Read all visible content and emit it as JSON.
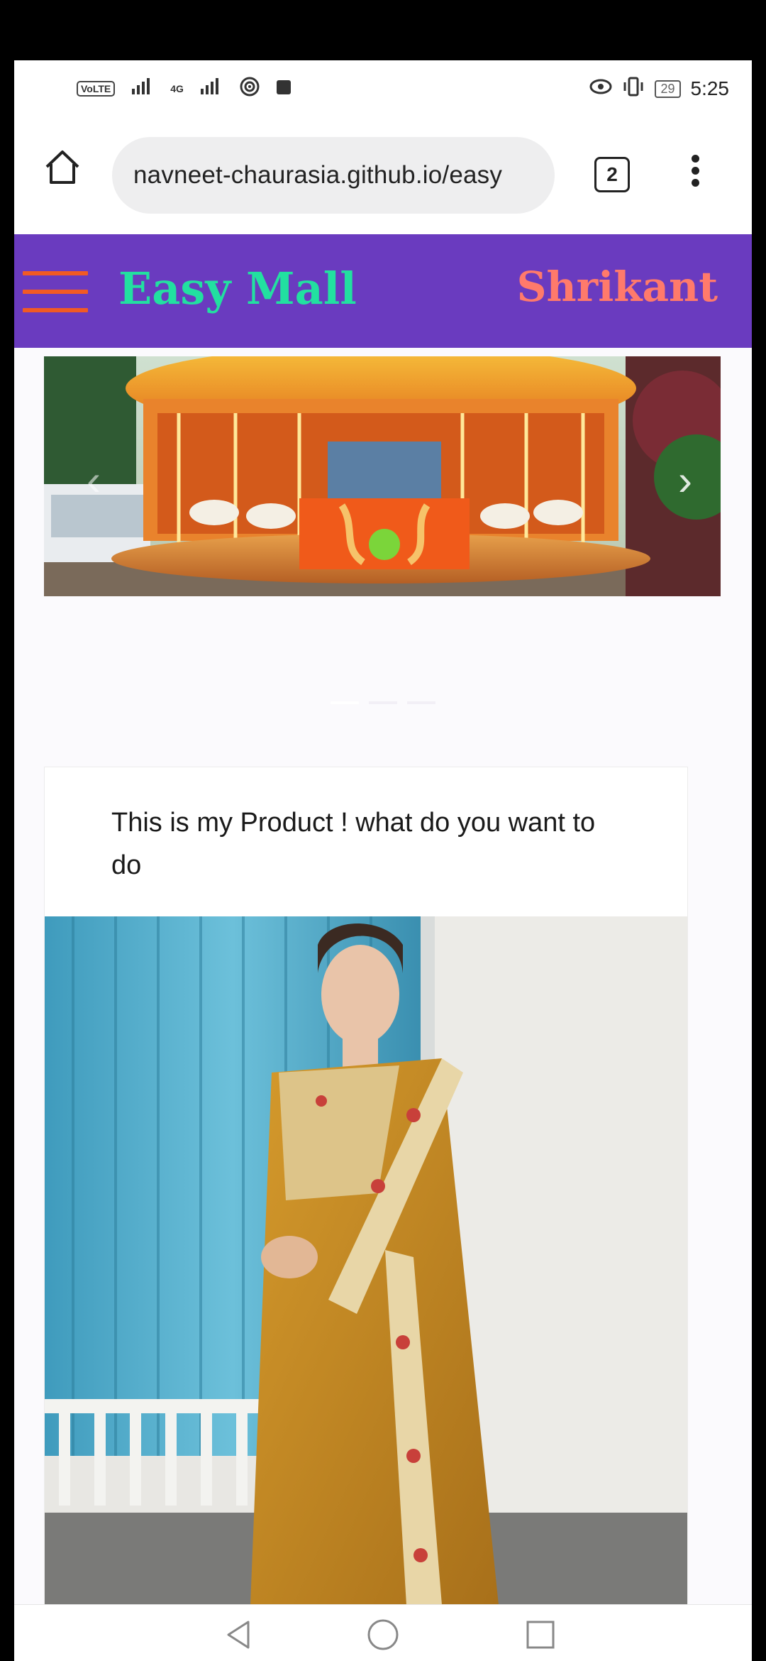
{
  "status_bar": {
    "volte": "VoLTE",
    "network": "4G",
    "battery": "29",
    "time": "5:25"
  },
  "browser": {
    "url": "navneet-chaurasia.github.io/easy",
    "tab_count": "2"
  },
  "navbar": {
    "brand": "Easy Mall",
    "user": "Shrikant"
  },
  "carousel": {
    "prev_icon": "chevron-left-icon",
    "next_icon": "chevron-right-icon"
  },
  "product_card": {
    "text": "This is my Product ! what do you want to do"
  },
  "colors": {
    "navbar_bg": "#6a3bbf",
    "brand": "#22e0a0",
    "user": "#ff7a6b",
    "hamburger": "#f15a24"
  }
}
